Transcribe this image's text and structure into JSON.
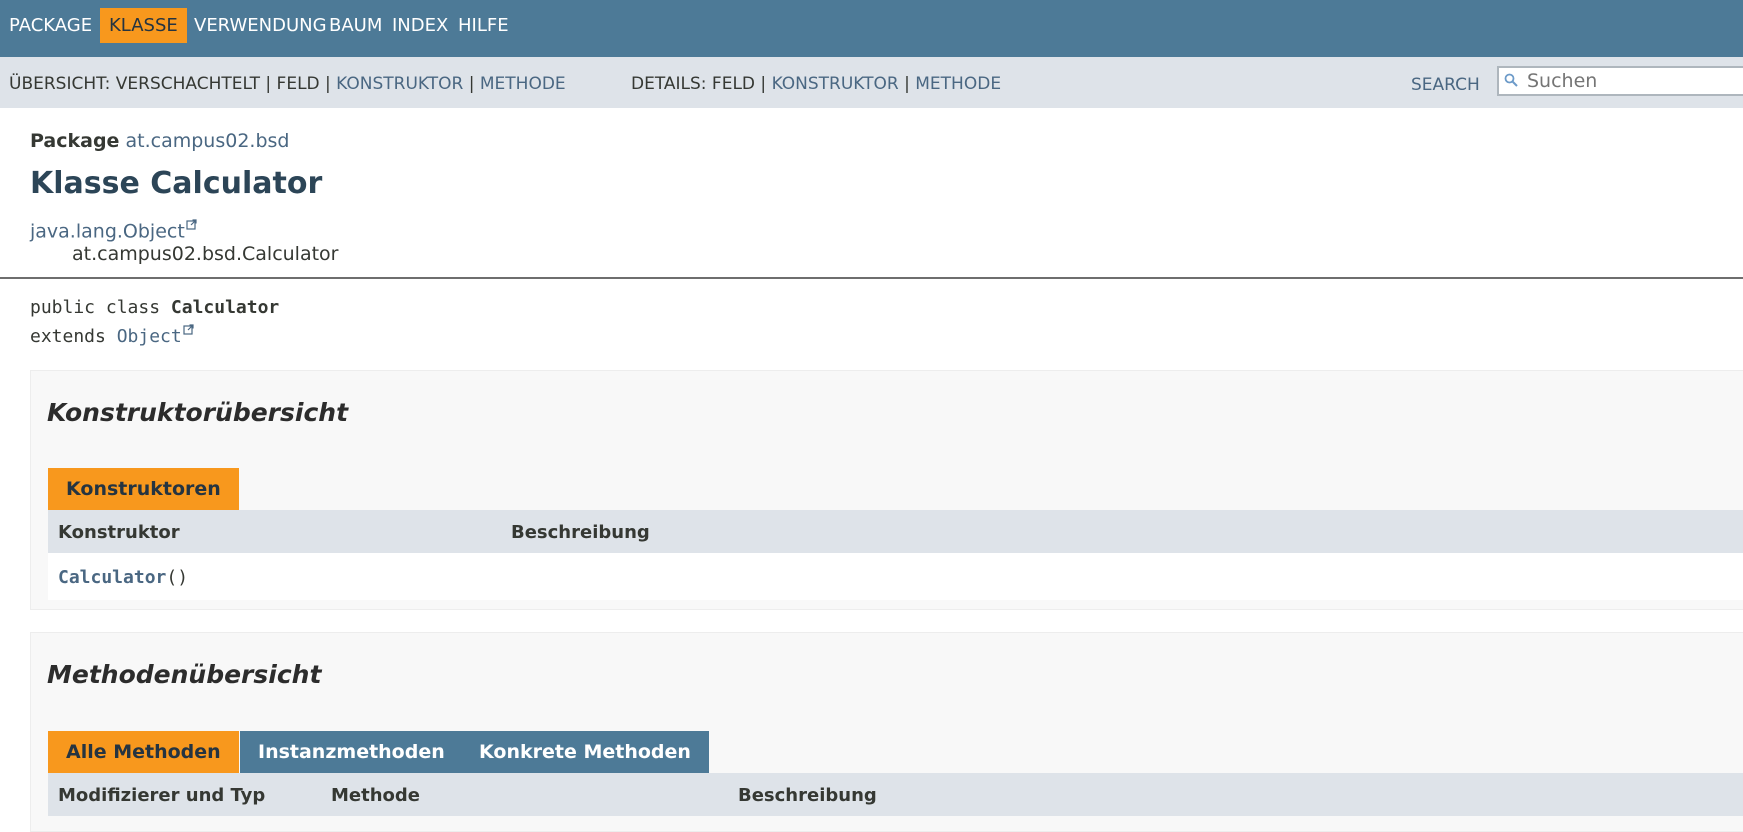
{
  "topnav": {
    "items": [
      "PACKAGE",
      "KLASSE",
      "VERWENDUNG",
      "BAUM",
      "INDEX",
      "HILFE"
    ],
    "active": "KLASSE"
  },
  "subnav": {
    "summary_prefix": "ÜBERSICHT: VERSCHACHTELT | FELD | ",
    "summary_konstruktor": "KONSTRUKTOR",
    "sep": " | ",
    "summary_methode": "METHODE",
    "details_prefix": "DETAILS: FELD | ",
    "details_konstruktor": "KONSTRUKTOR",
    "details_methode": "METHODE"
  },
  "search": {
    "label": "SEARCH",
    "placeholder": "Suchen"
  },
  "package": {
    "label": "Package",
    "name": "at.campus02.bsd"
  },
  "title": "Klasse Calculator",
  "inheritance": {
    "parent": "java.lang.Object",
    "child": "at.campus02.bsd.Calculator"
  },
  "signature": {
    "line1_prefix": "public class ",
    "class_name": "Calculator",
    "line2_prefix": "extends ",
    "super_name": "Object"
  },
  "constructor_summary": {
    "title": "Konstruktorübersicht",
    "tab": "Konstruktoren",
    "columns": [
      "Konstruktor",
      "Beschreibung"
    ],
    "rows": [
      {
        "name": "Calculator",
        "params": "()"
      }
    ]
  },
  "method_summary": {
    "title": "Methodenübersicht",
    "tabs": [
      "Alle Methoden",
      "Instanzmethoden",
      "Konkrete Methoden"
    ],
    "active_tab": "Alle Methoden",
    "columns": [
      "Modifizierer und Typ",
      "Methode",
      "Beschreibung"
    ]
  },
  "colors": {
    "nav_bg": "#4d7a97",
    "subnav_bg": "#dee3e9",
    "accent": "#f8981d",
    "link": "#4a6782"
  }
}
